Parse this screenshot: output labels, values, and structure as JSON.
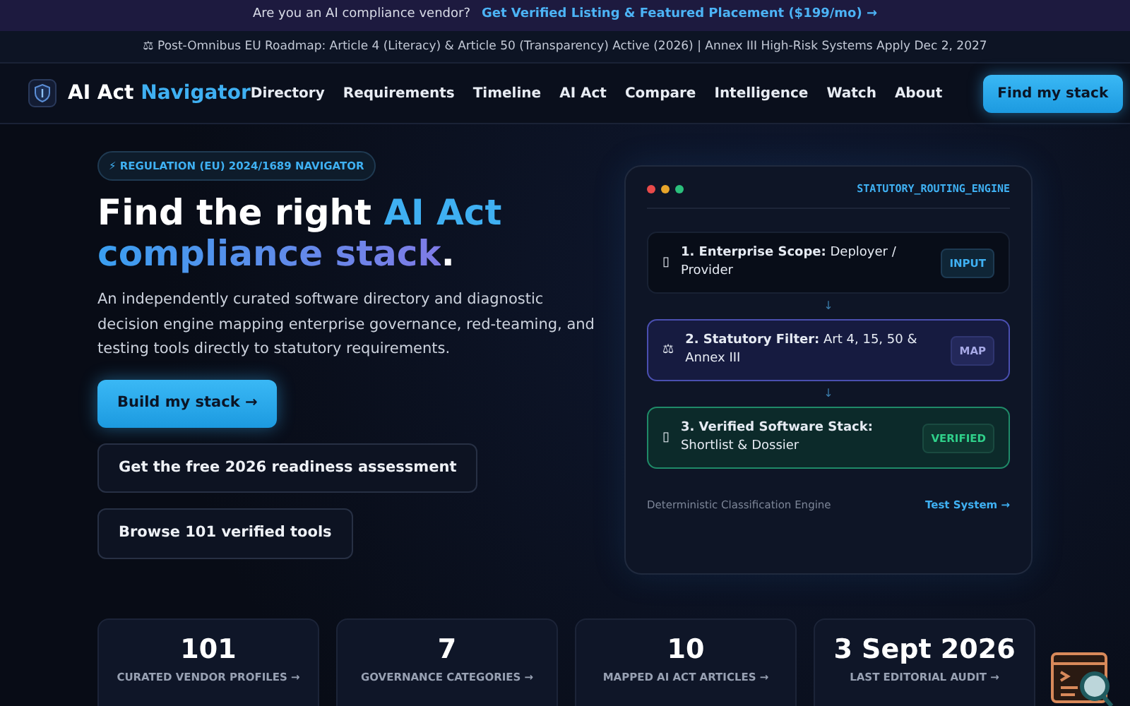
{
  "promo_bar": {
    "text": "Are you an AI compliance vendor?",
    "link": "Get Verified Listing & Featured Placement ($199/mo) →"
  },
  "notice_bar": {
    "text": "⚖ Post-Omnibus EU Roadmap: Article 4 (Literacy) & Article 50 (Transparency) Active (2026) | Annex III High-Risk Systems Apply Dec 2, 2027"
  },
  "navbar": {
    "brand": "AI Act",
    "brand_accent": "Navigator",
    "links": [
      "Directory",
      "Requirements",
      "Timeline",
      "AI Act",
      "Compare",
      "Intelligence",
      "Watch",
      "About"
    ],
    "cta": "Find my stack"
  },
  "hero": {
    "badge": "⚡ REGULATION (EU) 2024/1689 NAVIGATOR",
    "title_plain": "Find the right",
    "title_accent": "AI Act",
    "title_gradient": "compliance stack",
    "title_end": ".",
    "lead": "An independently curated software directory and diagnostic decision engine mapping enterprise governance, red-teaming, and testing tools directly to statutory requirements.",
    "buttons": [
      {
        "label": "Build my stack →",
        "kind": "primary"
      },
      {
        "label": "Get the free 2026 readiness assessment",
        "kind": "outline"
      },
      {
        "label": "Browse 101 verified tools",
        "kind": "outline"
      }
    ]
  },
  "engine": {
    "title": "STATUTORY_ROUTING_ENGINE",
    "steps": [
      {
        "icon": "▯",
        "label": "1. Enterprise Scope:",
        "text": "Deployer / Provider",
        "tag": "INPUT",
        "kind": "input"
      },
      {
        "icon": "⚖",
        "label": "2. Statutory Filter:",
        "text": "Art 4, 15, 50 & Annex III",
        "tag": "MAP",
        "kind": "map"
      },
      {
        "icon": "▯",
        "label": "3. Verified Software Stack:",
        "text": "Shortlist & Dossier",
        "tag": "VERIFIED",
        "kind": "verified"
      }
    ],
    "connector": "↓",
    "footer": "Deterministic Classification Engine",
    "link": "Test System →"
  },
  "stats": [
    {
      "value": "101",
      "label": "CURATED VENDOR PROFILES →"
    },
    {
      "value": "7",
      "label": "GOVERNANCE CATEGORIES →"
    },
    {
      "value": "10",
      "label": "MAPPED AI ACT ARTICLES →"
    },
    {
      "value": "3 Sept 2026",
      "label": "LAST EDITORIAL AUDIT →"
    }
  ]
}
